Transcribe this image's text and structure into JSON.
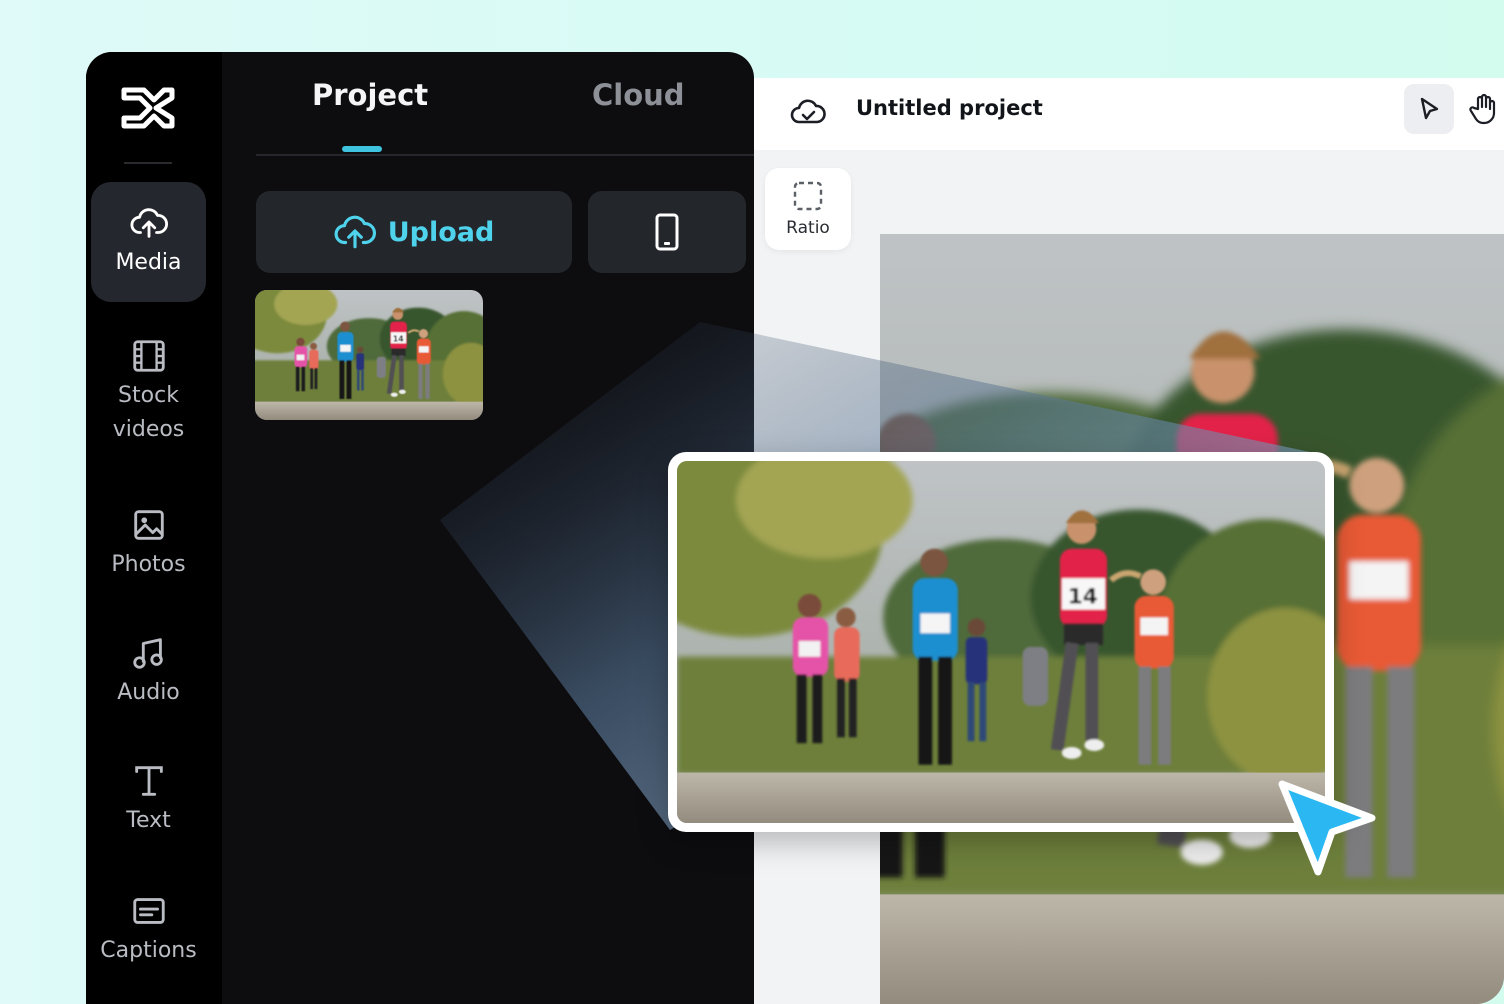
{
  "sidebar": {
    "logo_icon": "capcut-logo-icon",
    "items": [
      {
        "label": "Media",
        "icon": "cloud-upload-icon",
        "active": true
      },
      {
        "label": "Stock videos",
        "icon": "film-icon",
        "active": false
      },
      {
        "label": "Photos",
        "icon": "image-icon",
        "active": false
      },
      {
        "label": "Audio",
        "icon": "music-note-icon",
        "active": false
      },
      {
        "label": "Text",
        "icon": "text-icon",
        "active": false
      },
      {
        "label": "Captions",
        "icon": "captions-icon",
        "active": false
      }
    ]
  },
  "panel": {
    "tabs": [
      {
        "label": "Project",
        "active": true
      },
      {
        "label": "Cloud",
        "active": false
      }
    ],
    "upload_label": "Upload",
    "phone_icon": "phone-icon",
    "accent_color": "#3fc4df"
  },
  "editor": {
    "project_title": "Untitled project",
    "ratio_label": "Ratio",
    "tools": [
      "select-pointer-icon",
      "hand-pan-icon"
    ]
  },
  "overlay": {
    "cursor_color": "#2bb7f2"
  }
}
